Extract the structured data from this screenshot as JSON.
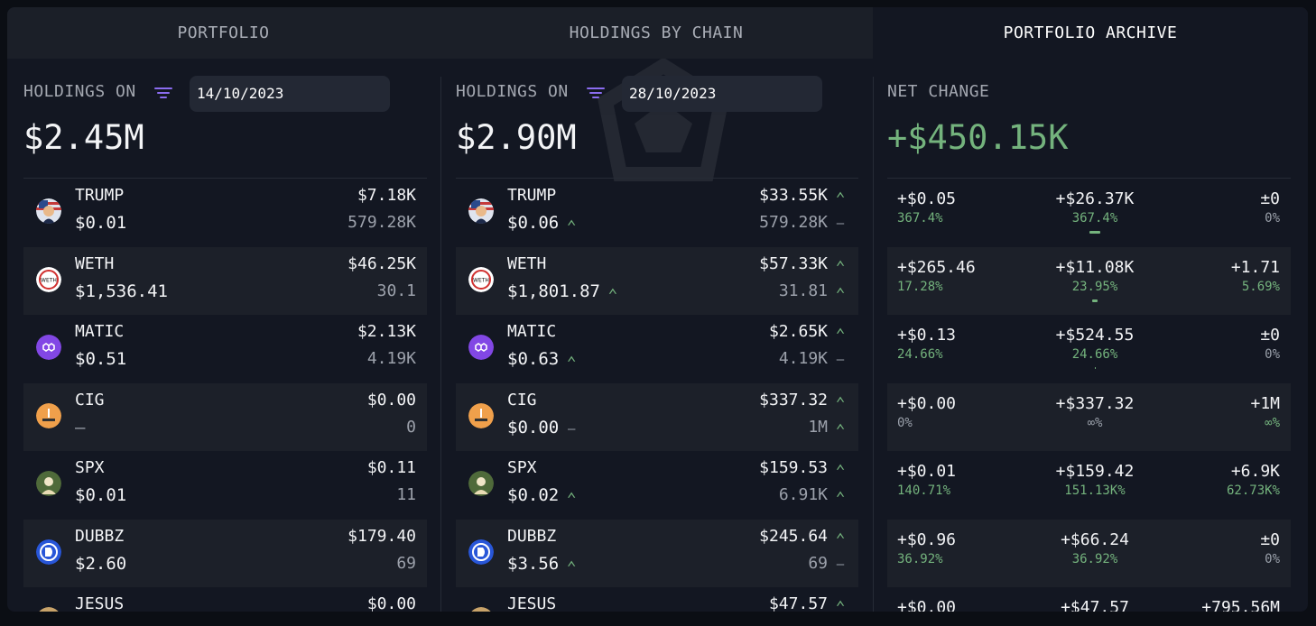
{
  "tabs": [
    {
      "label": "PORTFOLIO",
      "active": false
    },
    {
      "label": "HOLDINGS BY CHAIN",
      "active": false
    },
    {
      "label": "PORTFOLIO ARCHIVE",
      "active": true
    }
  ],
  "left": {
    "header": "HOLDINGS ON",
    "date": "14/10/2023",
    "total": "$2.45M",
    "rows": [
      {
        "symbol": "TRUMP",
        "price": "$0.01",
        "value": "$7.18K",
        "qty": "579.28K",
        "logo": "trump-logo"
      },
      {
        "symbol": "WETH",
        "price": "$1,536.41",
        "value": "$46.25K",
        "qty": "30.1",
        "logo": "weth-logo"
      },
      {
        "symbol": "MATIC",
        "price": "$0.51",
        "value": "$2.13K",
        "qty": "4.19K",
        "logo": "matic-logo"
      },
      {
        "symbol": "CIG",
        "price": "—",
        "value": "$0.00",
        "qty": "0",
        "logo": "cig-logo"
      },
      {
        "symbol": "SPX",
        "price": "$0.01",
        "value": "$0.11",
        "qty": "11",
        "logo": "spx-logo"
      },
      {
        "symbol": "DUBBZ",
        "price": "$2.60",
        "value": "$179.40",
        "qty": "69",
        "logo": "dubbz-logo"
      },
      {
        "symbol": "JESUS",
        "price": "",
        "value": "$0.00",
        "qty": "",
        "logo": "jesus-logo"
      }
    ]
  },
  "middle": {
    "header": "HOLDINGS ON",
    "date": "28/10/2023",
    "total": "$2.90M",
    "rows": [
      {
        "symbol": "TRUMP",
        "price": "$0.06",
        "price_mark": "up",
        "value": "$33.55K",
        "value_mark": "up",
        "qty": "579.28K",
        "qty_mark": "flat",
        "logo": "trump-logo"
      },
      {
        "symbol": "WETH",
        "price": "$1,801.87",
        "price_mark": "up",
        "value": "$57.33K",
        "value_mark": "up",
        "qty": "31.81",
        "qty_mark": "up",
        "logo": "weth-logo"
      },
      {
        "symbol": "MATIC",
        "price": "$0.63",
        "price_mark": "up",
        "value": "$2.65K",
        "value_mark": "up",
        "qty": "4.19K",
        "qty_mark": "flat",
        "logo": "matic-logo"
      },
      {
        "symbol": "CIG",
        "price": "$0.00",
        "price_mark": "flat",
        "value": "$337.32",
        "value_mark": "up",
        "qty": "1M",
        "qty_mark": "up",
        "logo": "cig-logo"
      },
      {
        "symbol": "SPX",
        "price": "$0.02",
        "price_mark": "up",
        "value": "$159.53",
        "value_mark": "up",
        "qty": "6.91K",
        "qty_mark": "up",
        "logo": "spx-logo"
      },
      {
        "symbol": "DUBBZ",
        "price": "$3.56",
        "price_mark": "up",
        "value": "$245.64",
        "value_mark": "up",
        "qty": "69",
        "qty_mark": "flat",
        "logo": "dubbz-logo"
      },
      {
        "symbol": "JESUS",
        "price": "",
        "price_mark": "",
        "value": "$47.57",
        "value_mark": "up",
        "qty": "",
        "qty_mark": "",
        "logo": "jesus-logo"
      }
    ]
  },
  "right": {
    "header": "NET CHANGE",
    "total": "+$450.15K",
    "rows": [
      {
        "price_change": "+$0.05",
        "price_pct": "367.4%",
        "value_change": "+$26.37K",
        "value_pct": "367.4%",
        "qty_change": "±0",
        "qty_pct": "0%",
        "bar_fraction": 0.8
      },
      {
        "price_change": "+$265.46",
        "price_pct": "17.28%",
        "value_change": "+$11.08K",
        "value_pct": "23.95%",
        "qty_change": "+1.71",
        "qty_pct": "5.69%",
        "bar_fraction": 0.4
      },
      {
        "price_change": "+$0.13",
        "price_pct": "24.66%",
        "value_change": "+$524.55",
        "value_pct": "24.66%",
        "qty_change": "±0",
        "qty_pct": "0%",
        "bar_fraction": 0.05
      },
      {
        "price_change": "+$0.00",
        "price_pct": "0%",
        "value_change": "+$337.32",
        "value_pct": "∞%",
        "qty_change": "+1M",
        "qty_pct": "∞%",
        "bar_fraction": 0
      },
      {
        "price_change": "+$0.01",
        "price_pct": "140.71%",
        "value_change": "+$159.42",
        "value_pct": "151.13K%",
        "qty_change": "+6.9K",
        "qty_pct": "62.73K%",
        "bar_fraction": 0
      },
      {
        "price_change": "+$0.96",
        "price_pct": "36.92%",
        "value_change": "+$66.24",
        "value_pct": "36.92%",
        "qty_change": "±0",
        "qty_pct": "0%",
        "bar_fraction": 0
      },
      {
        "price_change": "+$0.00",
        "price_pct": "",
        "value_change": "+$47.57",
        "value_pct": "",
        "qty_change": "+795.56M",
        "qty_pct": "",
        "bar_fraction": 0
      }
    ]
  },
  "colors": {
    "accent": "#8b6cf0",
    "positive": "#74b37d",
    "neutral": "#9aa0aa"
  }
}
